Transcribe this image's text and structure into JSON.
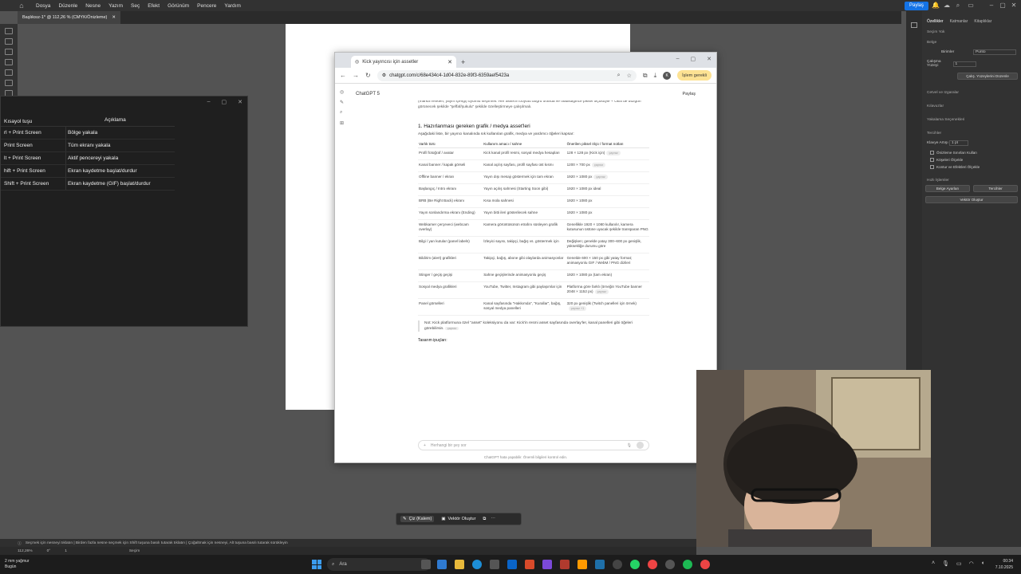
{
  "illustrator": {
    "menu": [
      "Dosya",
      "Düzenle",
      "Nesne",
      "Yazım",
      "Seç",
      "Efekt",
      "Görünüm",
      "Pencere",
      "Yardım"
    ],
    "share_label": "Paylaş",
    "doc_tab": "Başlıksız-1* @ 112,26 % (CMYK/Önizleme)",
    "props_tabs": [
      "Özellikler",
      "Katmanlar",
      "Kitaplıklar"
    ],
    "props": {
      "no_selection": "Seçim Yok",
      "document": "Belge",
      "units_label": "Birimler",
      "units_value": "Punto",
      "artboard_label": "Çalışma Yüzeyi",
      "artboard_value": "1",
      "edit_artboards": "Çalış. Yüzeylerini Düzenle",
      "rulers_grid": "Cetvel ve Izgaralar",
      "guides": "Kılavuzlar",
      "snap": "Yakalama Seçenekleri",
      "prefs": "Tercihler",
      "keyboard_inc_label": "Klavye Artışı",
      "keyboard_inc_value": "1 pt",
      "chk1": "Önizleme Sınırları Kullan",
      "chk2": "Köşeleri Ölçekle",
      "chk3": "Kontur ve Efektleri Ölçekle",
      "quick_actions": "Hızlı İşlemler",
      "doc_setup": "Belge Ayarları",
      "prefs_btn": "Tercihler",
      "vector": "Vektör Oluştur"
    },
    "context_bar": {
      "draw": "Çiz (Kalem)",
      "vector": "Vektör Oluştur"
    },
    "status": "Seçmek için nesneyi tıklatın  |  Birden fazla nesne seçmek için Shift tuşuna basılı tutarak tıklatın  |  Çoğaltmak için nesneyi, Alt tuşuna basılı tutarak sürükleyin",
    "zoom": "112,26%",
    "angle": "0°",
    "artboard_num": "1",
    "tool": "Seçim"
  },
  "shortcuts": {
    "headers": [
      "Kısayol tuşu",
      "Açıklama"
    ],
    "rows": [
      {
        "key": "rl + Print Screen",
        "desc": "Bölge yakala"
      },
      {
        "key": "Print Screen",
        "desc": "Tüm ekranı yakala"
      },
      {
        "key": "lt + Print Screen",
        "desc": "Aktif pencereyi yakala"
      },
      {
        "key": "hift + Print Screen",
        "desc": "Ekran kaydetme başlat/durdur"
      },
      {
        "key": "Shift + Print Screen",
        "desc": "Ekran kaydetme (GIF) başlat/durdur"
      }
    ]
  },
  "browser": {
    "tab_title": "Kick yayıncısı için assetler",
    "url": "chatgpt.com/c/68e434c4-1d04-832e-89f3-6359aef5423a",
    "update_label": "İşlem gerekli",
    "profile_letter": "K",
    "gpt_model": "ChatGPT 5",
    "share": "Paylaş",
    "intro": "(marka renkleri, yayın içeriği) uyumlu seçilmeli. Her asset'in boyutu doğru oranda ve olabildiğince piksel ölçüsüyle + OBS'de düzgün görünecek şekilde \"şeffaf/şukulu\" şekilde özelleştirmeye çalışılmalı.",
    "heading": "1. Hazırlanması gereken grafik / medya asset'leri",
    "subtext": "Aşağıdaki liste, bir yayıncı kanalında sık kullanılan grafik, medya ve yardımcı öğeleri kapsar:",
    "table_headers": [
      "Varlık türü",
      "Kullanım amacı / sahne",
      "Önerilen piksel ölçü / format notları"
    ],
    "table_rows": [
      {
        "a": "Profil fotoğraf / avatar",
        "b": "Kick kanal profil resmi, sosyal medya hesapları",
        "c": "128 × 128 px (Kick için)",
        "pill": "çapraz"
      },
      {
        "a": "Kanal banner / kapak görseli",
        "b": "Kanal açılış sayfası, profil sayfası üst kısmı",
        "c": "1200 × 700 px",
        "pill": "çapraz"
      },
      {
        "a": "Offline banner / ekran",
        "b": "Yayın dışı mesajı göstermek için tam ekran",
        "c": "1920 × 1080 px",
        "pill": "çapraz"
      },
      {
        "a": "Başlangıç / Intro ekranı",
        "b": "Yayın açılış sahnesi (Starting Soon gibi)",
        "c": "1920 × 1080 px ideal",
        "pill": ""
      },
      {
        "a": "BRB (Be Right Back) ekranı",
        "b": "Kısa mola sahnesi",
        "c": "1920 × 1080 px",
        "pill": ""
      },
      {
        "a": "Yayın sonlandırma ekranı (Ending)",
        "b": "Yayın bitti ileri gösterilecek sahne",
        "c": "1920 × 1080 px",
        "pill": ""
      },
      {
        "a": "Webkamer çerçeveci (webcam overlay)",
        "b": "Kamera görüntüsünün etrafını süsleyen grafik",
        "c": "Genellikle 1920 × 1080 kullanılır, kamera kutusunun üstüne uyacak şekilde transparan PNG",
        "pill": ""
      },
      {
        "a": "Bilgi / yan kutular (panel labels)",
        "b": "İzleyici sayısı, takipçi, bağış vs. göstermek için",
        "c": "Değişken; genelde yatay 300–600 px genişlik, yüksekliğe durumu göre",
        "pill": ""
      },
      {
        "a": "Bildirim (alert) grafikleri",
        "b": "Takipçi, bağış, abone gibi olaylarda animasyonlar",
        "c": "Genelde 600 × 150 px gibi yatay format; animasyonlu GIF / WebM / PNG dizileri",
        "pill": ""
      },
      {
        "a": "Stinger / geçiş geçişi",
        "b": "Sahne geçişlerinde animasyonlu geçiş",
        "c": "1920 × 1080 px (tam ekran)",
        "pill": ""
      },
      {
        "a": "Sosyal medya grafikleri",
        "b": "YouTube, Twitter, Instagram gibi paylaşımlar için",
        "c": "Platforma göre farklı (örneğin YouTube banner 2048 × 1152 px)",
        "pill": "çapraz"
      },
      {
        "a": "Panel görselleri",
        "b": "Kanal sayfasında \"Hakkımda\", \"Kurallar\", bağış, sosyal medya panelleri",
        "c": "320 px genişlik (Twitch panelleri için örnek)",
        "pill": "çapraz +1"
      }
    ],
    "note": "Not: Kick platformuna özel \"asset\" koleksiyonu da var: Kick'in resmi asset sayfasında overlay'ler, kanal panelleri gibi öğeleri görebilirsin.",
    "note_pill": "çapraz",
    "tips": "Tasarım ipuçları:",
    "composer_placeholder": "Herhangi bir şey sor",
    "footer": "ChatGPT hata yapabilir. Önemli bilgileri kontrol edin."
  },
  "taskbar": {
    "weather_temp": "2 mm yağmur",
    "weather_desc": "Bugün",
    "search": "Ara",
    "time": "00:34",
    "date": "7.10.2025"
  }
}
